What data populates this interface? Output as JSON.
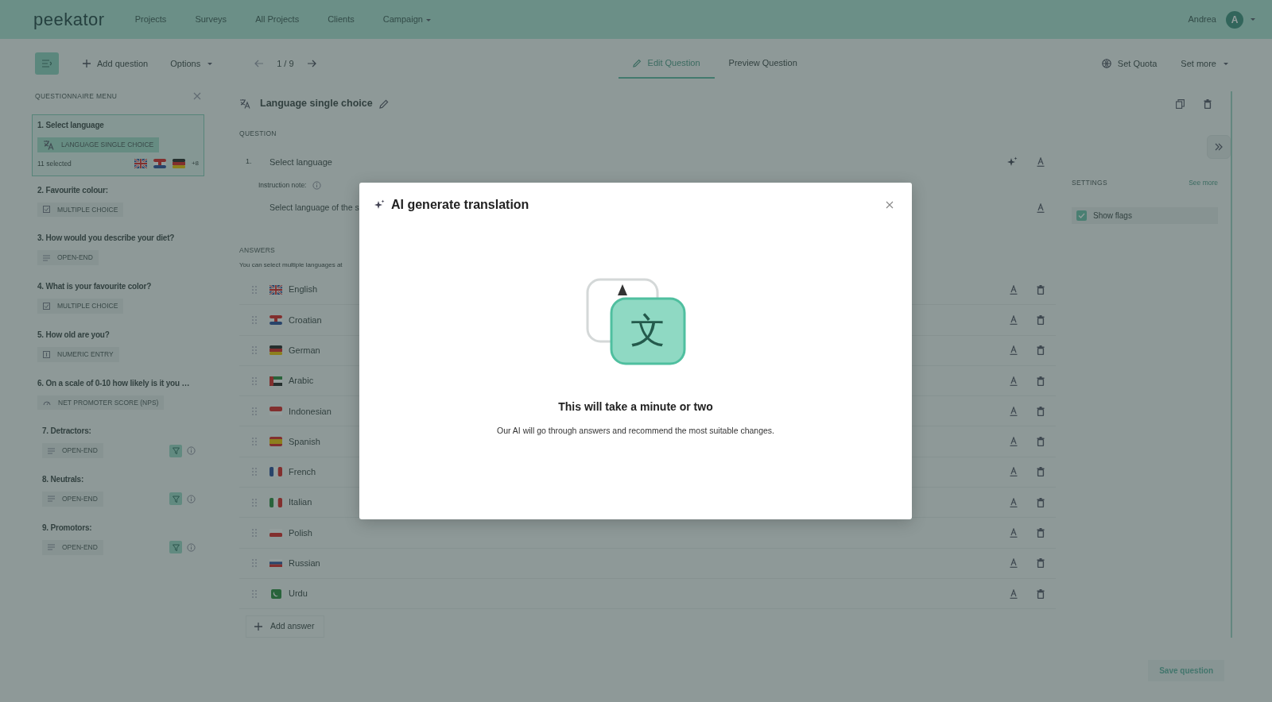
{
  "navbar": {
    "logo": "peekator",
    "links": [
      {
        "label": "Projects",
        "dropdown": false
      },
      {
        "label": "Surveys",
        "dropdown": false
      },
      {
        "label": "All Projects",
        "dropdown": false
      },
      {
        "label": "Clients",
        "dropdown": false
      },
      {
        "label": "Campaign",
        "dropdown": true
      }
    ],
    "user": {
      "name": "Andrea",
      "initial": "A"
    }
  },
  "toolbar": {
    "add_question": "Add question",
    "options": "Options",
    "pager": "1 / 9",
    "tabs": [
      {
        "label": "Edit Question",
        "selected": true
      },
      {
        "label": "Preview Question",
        "selected": false
      }
    ],
    "set_quota": "Set Quota",
    "set_more": "Set more"
  },
  "sidebar": {
    "title": "QUESTIONNAIRE MENU",
    "items": [
      {
        "title": "1. Select language",
        "type": "LANGUAGE SINGLE CHOICE",
        "kind": "language",
        "selected": true,
        "logic": false,
        "summary": "11 selected",
        "more": "+8"
      },
      {
        "title": "2. Favourite colour:",
        "type": "MULTIPLE CHOICE",
        "kind": "multiple",
        "selected": false,
        "logic": false
      },
      {
        "title": "3. How would you describe your diet?",
        "type": "OPEN-END",
        "kind": "open",
        "selected": false,
        "logic": false
      },
      {
        "title": "4. What is your favourite color?",
        "type": "MULTIPLE CHOICE",
        "kind": "multiple",
        "selected": false,
        "logic": false
      },
      {
        "title": "5. How old are you?",
        "type": "NUMERIC ENTRY",
        "kind": "numeric",
        "selected": false,
        "logic": false
      },
      {
        "title": "6. On a scale of 0-10 how likely is it you …",
        "type": "NET PROMOTER SCORE (NPS)",
        "kind": "nps",
        "selected": false,
        "logic": false,
        "children": [
          {
            "title": "7. Detractors:",
            "type": "OPEN-END",
            "kind": "open",
            "selected": false,
            "logic": true
          },
          {
            "title": "8. Neutrals:",
            "type": "OPEN-END",
            "kind": "open",
            "selected": false,
            "logic": true
          },
          {
            "title": "9. Promotors:",
            "type": "OPEN-END",
            "kind": "open",
            "selected": false,
            "logic": true
          }
        ]
      }
    ]
  },
  "main": {
    "title": "Language single choice",
    "question_label": "QUESTION",
    "question": {
      "number": "1.",
      "text": "Select language",
      "note_label": "Instruction note:",
      "note": "Select language of the s"
    },
    "answers_label": "ANSWERS",
    "answers_hint": "You can select multiple languages at",
    "answers": [
      {
        "label": "English"
      },
      {
        "label": "Croatian"
      },
      {
        "label": "German"
      },
      {
        "label": "Arabic"
      },
      {
        "label": "Indonesian"
      },
      {
        "label": "Spanish"
      },
      {
        "label": "French"
      },
      {
        "label": "Italian"
      },
      {
        "label": "Polish"
      },
      {
        "label": "Russian"
      },
      {
        "label": "Urdu"
      }
    ],
    "add_answer": "Add answer",
    "save": "Save question"
  },
  "settings": {
    "title": "SETTINGS",
    "see_more": "See more",
    "options": [
      {
        "label": "Show flags",
        "checked": true
      }
    ]
  },
  "dialog": {
    "title": "AI generate translation",
    "glyph": "文",
    "heading": "This will take a minute or two",
    "text": "Our AI will go through answers and recommend the most suitable changes."
  }
}
